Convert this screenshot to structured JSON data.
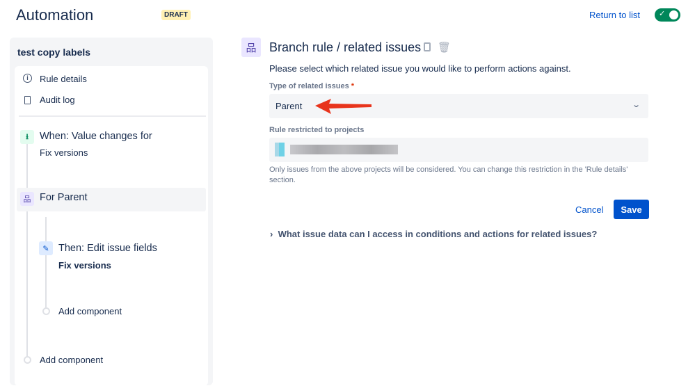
{
  "header": {
    "title": "Automation",
    "badge": "DRAFT",
    "return_link": "Return to list",
    "toggle_on": true
  },
  "sidebar": {
    "rule_name": "test copy labels",
    "links": [
      {
        "label": "Rule details",
        "icon": "info-icon"
      },
      {
        "label": "Audit log",
        "icon": "document-icon"
      }
    ],
    "trigger": {
      "title": "When: Value changes for",
      "detail": "Fix versions"
    },
    "branch": {
      "title": "For Parent"
    },
    "action": {
      "title": "Then: Edit issue fields",
      "detail": "Fix versions"
    },
    "add_inner": "Add component",
    "add_outer": "Add component"
  },
  "main": {
    "title": "Branch rule / related issues",
    "description": "Please select which related issue you would like to perform actions against.",
    "type_label": "Type of related issues",
    "required_mark": "*",
    "type_value": "Parent",
    "projects_label": "Rule restricted to projects",
    "help": "Only issues from the above projects will be considered. You can change this restriction in the 'Rule details' section.",
    "cancel": "Cancel",
    "save": "Save",
    "expander": "What issue data can I access in conditions and actions for related issues?"
  },
  "colors": {
    "accent": "#0052cc",
    "toggle": "#00875a",
    "annotation_arrow": "#e8341c"
  }
}
